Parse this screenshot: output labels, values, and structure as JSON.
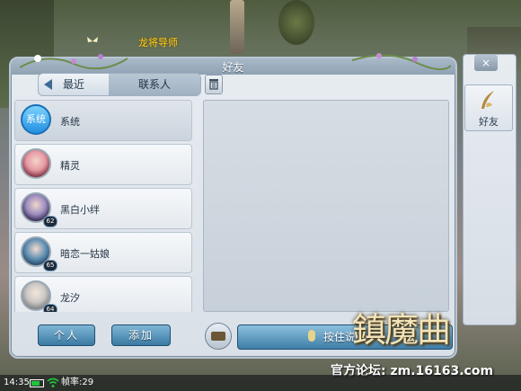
{
  "scene": {
    "npc_name": "龙将导师"
  },
  "window": {
    "title": "好友",
    "close_glyph": "×"
  },
  "tabs": [
    {
      "label": "最近"
    },
    {
      "label": "联系人"
    }
  ],
  "contacts": [
    {
      "name": "系统",
      "avatar": "系统",
      "level": ""
    },
    {
      "name": "精灵",
      "avatar": "fairy-avatar",
      "level": ""
    },
    {
      "name": "黑白小绊",
      "avatar": "portrait",
      "level": "62"
    },
    {
      "name": "暗恋一姑娘",
      "avatar": "portrait",
      "level": "65"
    },
    {
      "name": "龙汐",
      "avatar": "portrait",
      "level": "64"
    }
  ],
  "buttons": {
    "personal": "个人",
    "add": "添加",
    "hold_to_talk": "按住说话"
  },
  "side_panel": {
    "tab_label": "好友"
  },
  "status_bar": {
    "time": "14:35",
    "fps_label": "帧率:29"
  },
  "watermark": {
    "logo_text": "镇魔曲",
    "forum_text": "官方论坛: zm.16163.com"
  },
  "colors": {
    "accent": "#3b7aa3",
    "npc_name": "#ffd21e"
  }
}
